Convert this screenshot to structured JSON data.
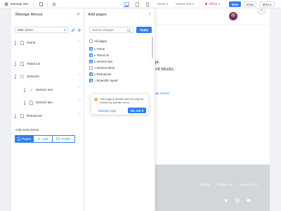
{
  "topbar": {
    "manage_site": "Manage site",
    "language": "Home",
    "version": "Version 004",
    "status": "Offline",
    "save": "Save",
    "share": "Share",
    "more": "More"
  },
  "menus_panel": {
    "title": "Manage Menus",
    "menu_select": "Main menu",
    "items": [
      {
        "label": "Home"
      },
      {
        "label": "About Us"
      },
      {
        "label": "Services"
      },
      {
        "label": "Service one"
      },
      {
        "label": "Service two"
      },
      {
        "label": "Resources"
      }
    ],
    "add_items_label": "Add menu items",
    "segments": [
      "Pages",
      "Link",
      "Folder"
    ]
  },
  "add_pages_panel": {
    "title": "Add pages",
    "search_placeholder": "Search all pages",
    "add_button": "Apply",
    "all_pages": "All pages",
    "pages": [
      {
        "label": "Home",
        "checked": true,
        "private": false
      },
      {
        "label": "About us",
        "checked": true,
        "private": false
      },
      {
        "label": "Service two",
        "checked": true,
        "private": false
      },
      {
        "label": "Service three",
        "checked": false,
        "private": false
      },
      {
        "label": "Resources",
        "checked": true,
        "private": false
      },
      {
        "label": "Scientific report",
        "checked": true,
        "private": true
      }
    ]
  },
  "tooltip": {
    "message": "This page is private and can only be viewed by specific users",
    "link": "Manage page",
    "ok": "Ok, Got it"
  },
  "canvas": {
    "hero_line1": "ge.",
    "hero_line2": "ent blocks.",
    "manage_menus_link": "age menus",
    "footer_links": [
      "Privacy",
      "Contact Us",
      "Terms of Use"
    ]
  },
  "colors": {
    "accent": "#2f80ed",
    "offline": "#e04848",
    "footer": "#d2d5da"
  }
}
